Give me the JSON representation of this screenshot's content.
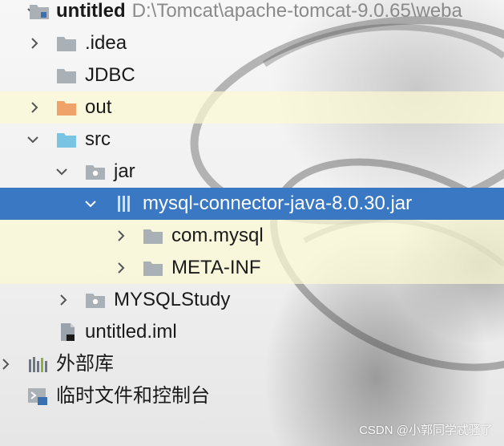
{
  "tree": {
    "root": {
      "name": "untitled",
      "path": "D:\\Tomcat\\apache-tomcat-9.0.65\\weba"
    },
    "items": [
      {
        "label": ".idea"
      },
      {
        "label": "JDBC"
      },
      {
        "label": "out"
      },
      {
        "label": "src"
      },
      {
        "label": "jar"
      },
      {
        "label": "mysql-connector-java-8.0.30.jar"
      },
      {
        "label": "com.mysql"
      },
      {
        "label": "META-INF"
      },
      {
        "label": "MYSQLStudy"
      },
      {
        "label": "untitled.iml"
      },
      {
        "label": "外部库"
      },
      {
        "label": "临时文件和控制台"
      }
    ]
  },
  "colors": {
    "selection": "#3b78c3",
    "folder_gray": "#a9b0b6",
    "folder_out": "#f0a26b",
    "folder_src": "#79c4e3"
  },
  "watermark": "CSDN @小郭同学忒骚了"
}
